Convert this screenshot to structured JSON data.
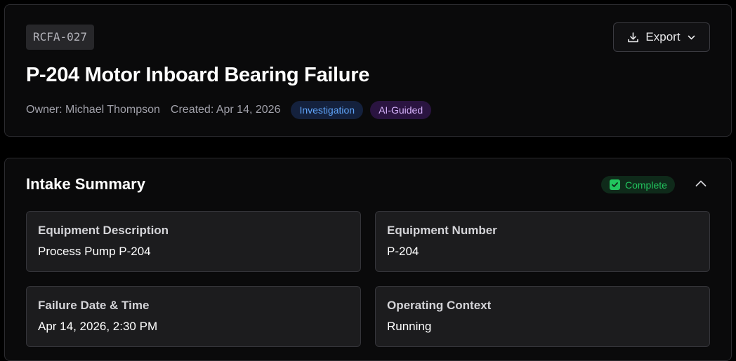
{
  "header": {
    "case_id": "RCFA-027",
    "export_label": "Export",
    "title": "P-204 Motor Inboard Bearing Failure",
    "owner": "Owner: Michael Thompson",
    "created": "Created: Apr 14, 2026",
    "badges": [
      {
        "label": "Investigation",
        "color": "#60a5fa"
      },
      {
        "label": "AI-Guided",
        "color": "#d8b4fe"
      }
    ]
  },
  "intake": {
    "title": "Intake Summary",
    "status": "Complete",
    "status_color": "#22c55e",
    "collapse_icon": "chevron-up-icon",
    "fields": [
      {
        "label": "Equipment Description",
        "value": "Process Pump P-204"
      },
      {
        "label": "Equipment Number",
        "value": "P-204"
      },
      {
        "label": "Failure Date & Time",
        "value": "Apr 14, 2026, 2:30 PM"
      },
      {
        "label": "Operating Context",
        "value": "Running"
      }
    ]
  }
}
